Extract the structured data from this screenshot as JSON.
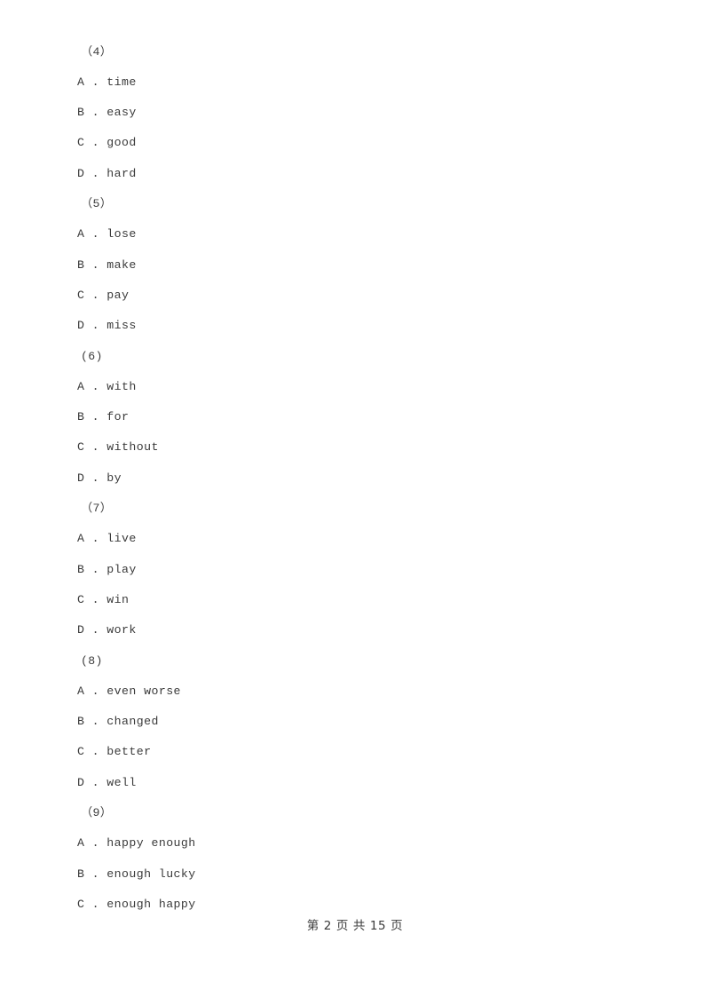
{
  "document": {
    "page_label": "第 2 页 共 15 页",
    "page_number": "2",
    "total_pages": "15",
    "text_color": "#3a3a3a",
    "background_color": "#ffffff"
  },
  "blocks": [
    {
      "number": "（4）",
      "options": [
        {
          "letter": "A",
          "separator": " . ",
          "text": "time"
        },
        {
          "letter": "B",
          "separator": " . ",
          "text": "easy"
        },
        {
          "letter": "C",
          "separator": " . ",
          "text": "good"
        },
        {
          "letter": "D",
          "separator": " . ",
          "text": "hard"
        }
      ]
    },
    {
      "number": "（5）",
      "options": [
        {
          "letter": "A",
          "separator": " . ",
          "text": "lose"
        },
        {
          "letter": "B",
          "separator": " . ",
          "text": "make"
        },
        {
          "letter": "C",
          "separator": " . ",
          "text": "pay"
        },
        {
          "letter": "D",
          "separator": " . ",
          "text": "miss"
        }
      ]
    },
    {
      "number": "(6)",
      "options": [
        {
          "letter": "A",
          "separator": " . ",
          "text": "with"
        },
        {
          "letter": "B",
          "separator": " . ",
          "text": "for"
        },
        {
          "letter": "C",
          "separator": " . ",
          "text": "without"
        },
        {
          "letter": "D",
          "separator": " . ",
          "text": "by"
        }
      ]
    },
    {
      "number": "（7）",
      "options": [
        {
          "letter": "A",
          "separator": " . ",
          "text": "live"
        },
        {
          "letter": "B",
          "separator": " . ",
          "text": "play"
        },
        {
          "letter": "C",
          "separator": " . ",
          "text": "win"
        },
        {
          "letter": "D",
          "separator": " . ",
          "text": "work"
        }
      ]
    },
    {
      "number": "(8)",
      "options": [
        {
          "letter": "A",
          "separator": " . ",
          "text": "even worse"
        },
        {
          "letter": "B",
          "separator": " . ",
          "text": "changed"
        },
        {
          "letter": "C",
          "separator": " . ",
          "text": "better"
        },
        {
          "letter": "D",
          "separator": " . ",
          "text": "well"
        }
      ]
    },
    {
      "number": "（9）",
      "options": [
        {
          "letter": "A",
          "separator": " . ",
          "text": "happy enough"
        },
        {
          "letter": "B",
          "separator": " . ",
          "text": "enough lucky"
        },
        {
          "letter": "C",
          "separator": " . ",
          "text": "enough happy"
        }
      ]
    }
  ]
}
